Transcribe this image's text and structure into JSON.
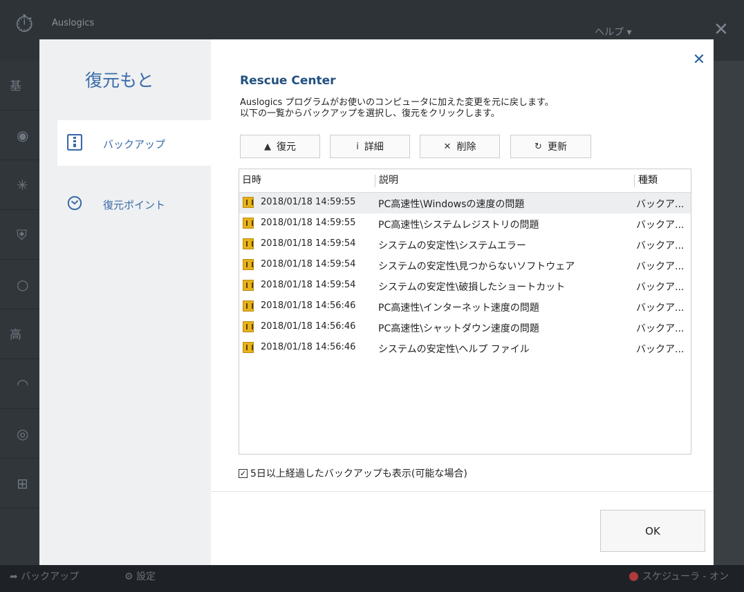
{
  "background": {
    "brand": "Auslogics",
    "help_menu": "ヘルプ ▾",
    "sidebar_labels": [
      "基",
      "高"
    ],
    "bottom_backup": "バックアップ",
    "bottom_settings": "設定",
    "bottom_status": "スケジューラ - オン"
  },
  "dialog": {
    "left_title": "復元もと",
    "nav": [
      {
        "label": "バックアップ",
        "icon": "backup-archive-icon",
        "active": true
      },
      {
        "label": "復元ポイント",
        "icon": "restore-point-icon",
        "active": false
      }
    ],
    "heading": "Rescue Center",
    "description": [
      "Auslogics プログラムがお使いのコンピュータに加えた変更を元に戻します。",
      "以下の一覧からバックアップを選択し、復元をクリックします。"
    ],
    "toolbar": {
      "restore": "復元",
      "details": "詳細",
      "delete": "削除",
      "refresh": "更新"
    },
    "columns": {
      "datetime": "日時",
      "description": "説明",
      "type": "種類"
    },
    "rows": [
      {
        "datetime": "2018/01/18 14:59:55",
        "description": "PC高速性\\Windowsの速度の問題",
        "type": "バックア..."
      },
      {
        "datetime": "2018/01/18 14:59:55",
        "description": "PC高速性\\システムレジストリの問題",
        "type": "バックア..."
      },
      {
        "datetime": "2018/01/18 14:59:54",
        "description": "システムの安定性\\システムエラー",
        "type": "バックア..."
      },
      {
        "datetime": "2018/01/18 14:59:54",
        "description": "システムの安定性\\見つからないソフトウェア",
        "type": "バックア..."
      },
      {
        "datetime": "2018/01/18 14:59:54",
        "description": "システムの安定性\\破損したショートカット",
        "type": "バックア..."
      },
      {
        "datetime": "2018/01/18 14:56:46",
        "description": "PC高速性\\インターネット速度の問題",
        "type": "バックア..."
      },
      {
        "datetime": "2018/01/18 14:56:46",
        "description": "PC高速性\\シャットダウン速度の問題",
        "type": "バックア..."
      },
      {
        "datetime": "2018/01/18 14:56:46",
        "description": "システムの安定性\\ヘルプ ファイル",
        "type": "バックア..."
      }
    ],
    "show_old_checkbox": {
      "label": "5日以上経過したバックアップも表示(可能な場合)",
      "checked": true
    },
    "ok": "OK"
  },
  "colors": {
    "accent": "#3b6aa8",
    "heading": "#22507e",
    "backdrop": "#33383d",
    "file_icon": "#e8b21c"
  }
}
